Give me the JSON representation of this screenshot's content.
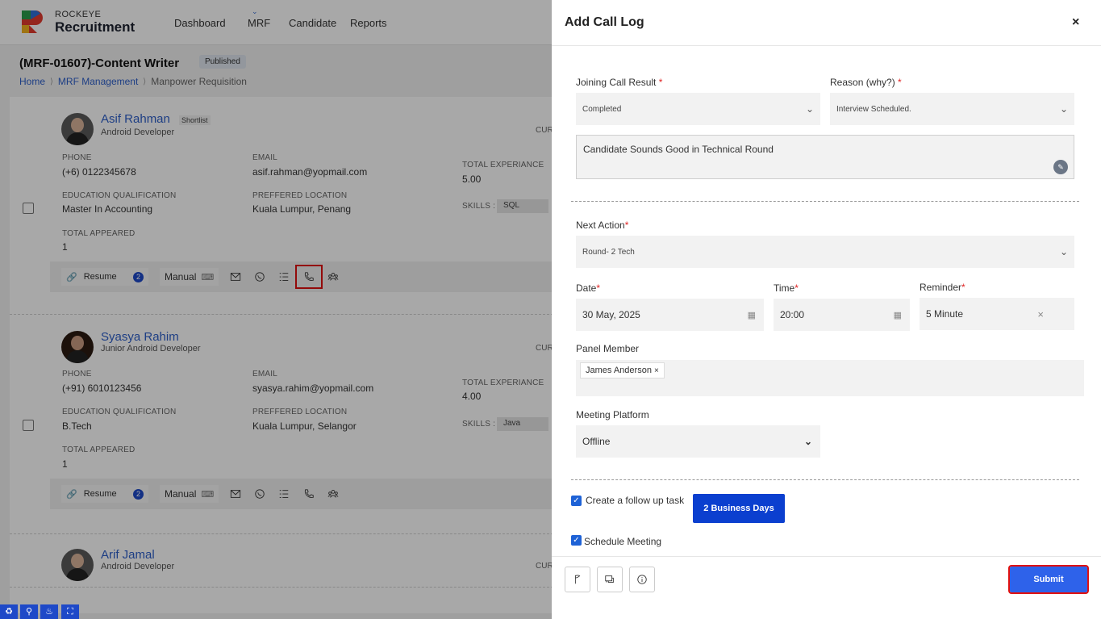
{
  "brand": {
    "small": "ROCKEYE",
    "big": "Recruitment"
  },
  "nav": [
    "Dashboard",
    "MRF",
    "Candidate",
    "Reports"
  ],
  "page": {
    "title": "(MRF-01607)-Content Writer",
    "status": "Published"
  },
  "breadcrumb": [
    "Home",
    "MRF Management",
    "Manpower Requisition"
  ],
  "labels": {
    "phone": "PHONE",
    "email": "EMAIL",
    "total_exp": "TOTAL EXPERIANCE",
    "education": "EDUCATION QUALIFICATION",
    "location": "PREFFERED LOCATION",
    "skills": "SKILLS :",
    "appeared": "TOTAL APPEARED",
    "resume": "Resume",
    "manual": "Manual",
    "cut": "CUR"
  },
  "candidates": [
    {
      "name": "Asif Rahman",
      "tag": "Shortlist",
      "role": "Android Developer",
      "phone": "(+6) 0122345678",
      "email": "asif.rahman@yopmail.com",
      "experience": "5.00",
      "education": "Master In Accounting",
      "location": "Kuala Lumpur, Penang",
      "skill": "SQL",
      "appeared": "1",
      "resume_count": "2"
    },
    {
      "name": "Syasya Rahim",
      "tag": "",
      "role": "Junior Android Developer",
      "phone": "(+91) 6010123456",
      "email": "syasya.rahim@yopmail.com",
      "experience": "4.00",
      "education": "B.Tech",
      "location": "Kuala Lumpur, Selangor",
      "skill": "Java",
      "appeared": "1",
      "resume_count": "2"
    },
    {
      "name": "Arif Jamal",
      "tag": "",
      "role": "Android Developer"
    }
  ],
  "modal": {
    "title": "Add Call Log",
    "close": "×",
    "joining_label": "Joining Call Result",
    "joining_value": "Completed",
    "reason_label": "Reason (why?)",
    "reason_value": "Interview Scheduled.",
    "notes": "Candidate Sounds Good in Technical Round",
    "next_action_label": "Next Action",
    "next_action_value": "Round- 2 Tech",
    "date_label": "Date",
    "date_value": "30 May, 2025",
    "time_label": "Time",
    "time_value": "20:00",
    "reminder_label": "Reminder",
    "reminder_value": "5 Minute",
    "panel_label": "Panel Member",
    "panel_member": "James Anderson",
    "platform_label": "Meeting Platform",
    "platform_value": "Offline",
    "followup_label": "Create a follow up task",
    "followup_btn": "2 Business Days",
    "schedule_label": "Schedule Meeting",
    "submit": "Submit"
  },
  "colors": {
    "accent": "#1e49c8",
    "highlight": "#e01010",
    "required": "#e02424"
  }
}
